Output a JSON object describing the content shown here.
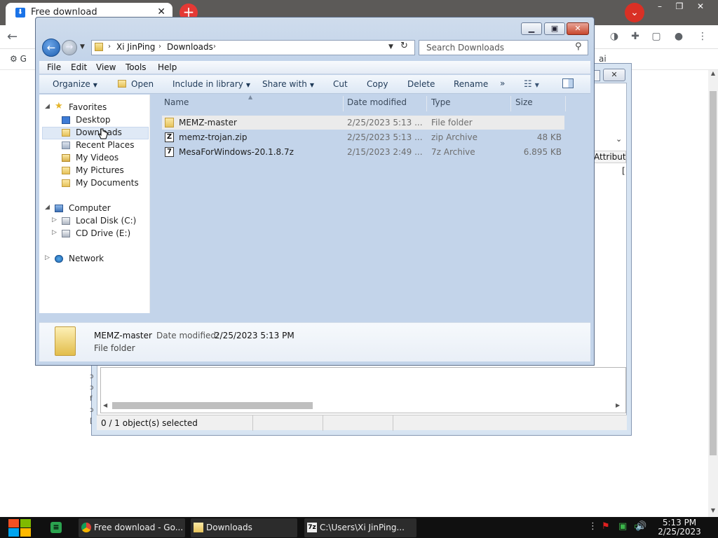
{
  "browser": {
    "tab_title": "Free download",
    "tab_favicon": "download-icon",
    "bookmark_left": "G",
    "bookmark_right": "ai",
    "accent": "#e53935"
  },
  "background_window": {
    "attribute_header": "Attribute",
    "cell_bracket": "[",
    "status_text": "0 / 1 object(s) selected"
  },
  "explorer": {
    "address": {
      "crumbs": [
        "Xi JinPing",
        "Downloads"
      ]
    },
    "search": {
      "placeholder": "Search Downloads"
    },
    "menu": [
      "File",
      "Edit",
      "View",
      "Tools",
      "Help"
    ],
    "commands": {
      "organize": "Organize",
      "open": "Open",
      "include": "Include in library",
      "share": "Share with",
      "cut": "Cut",
      "copy": "Copy",
      "delete": "Delete",
      "rename": "Rename",
      "more": "»"
    },
    "nav": {
      "favorites": "Favorites",
      "desktop": "Desktop",
      "downloads": "Downloads",
      "recent": "Recent Places",
      "videos": "My Videos",
      "pictures": "My Pictures",
      "documents": "My Documents",
      "computer": "Computer",
      "local_disk": "Local Disk (C:)",
      "cd_drive": "CD Drive (E:)",
      "network": "Network"
    },
    "columns": {
      "name": "Name",
      "date": "Date modified",
      "type": "Type",
      "size": "Size"
    },
    "files": [
      {
        "name": "MEMZ-master",
        "date": "2/25/2023 5:13 ...",
        "type": "File folder",
        "size": "",
        "icon": "folder-icon"
      },
      {
        "name": "memz-trojan.zip",
        "date": "2/25/2023 5:13 ...",
        "type": "zip Archive",
        "size": "48 KB",
        "icon": "zip-archive-icon"
      },
      {
        "name": "MesaForWindows-20.1.8.7z",
        "date": "2/15/2023 2:49 ...",
        "type": "7z Archive",
        "size": "6.895 KB",
        "icon": "7z-archive-icon"
      }
    ],
    "details": {
      "name": "MEMZ-master",
      "date_label": "Date modified:",
      "date": "2/25/2023 5:13 PM",
      "type": "File folder"
    }
  },
  "taskbar": {
    "apps": [
      {
        "label": "Free download - Go...",
        "icon": "chrome-icon"
      },
      {
        "label": "Downloads",
        "icon": "folder-icon"
      },
      {
        "label": "C:\\Users\\Xi JinPing...",
        "icon": "7zip-icon"
      }
    ],
    "clock_time": "5:13 PM",
    "clock_date": "2/25/2023"
  }
}
